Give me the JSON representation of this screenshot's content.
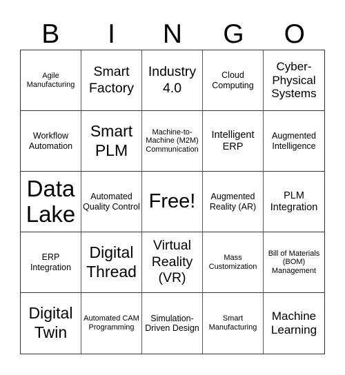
{
  "header": {
    "letters": [
      "B",
      "I",
      "N",
      "G",
      "O"
    ]
  },
  "cells": [
    "Agile Manufacturing",
    "Smart Factory",
    "Industry 4.0",
    "Cloud Computing",
    "Cyber-Physical Systems",
    "Workflow Automation",
    "Smart PLM",
    "Machine-to-Machine (M2M) Communication",
    "Intelligent ERP",
    "Augmented Intelligence",
    "Data Lake",
    "Automated Quality Control",
    "Free!",
    "Augmented Reality (AR)",
    "PLM Integration",
    "ERP Integration",
    "Digital Thread",
    "Virtual Reality (VR)",
    "Mass Customization",
    "Bill of Materials (BOM) Management",
    "Digital Twin",
    "Automated CAM Programming",
    "Simulation-Driven Design",
    "Smart Manufacturing",
    "Machine Learning"
  ]
}
